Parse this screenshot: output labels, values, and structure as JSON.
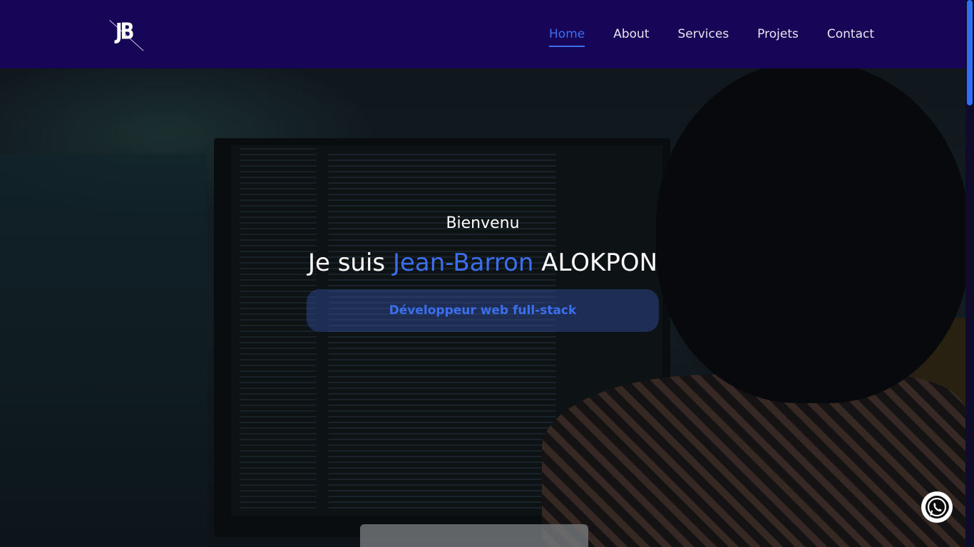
{
  "brand": {
    "logo_text": "JB"
  },
  "nav": {
    "items": [
      {
        "label": "Home",
        "active": true
      },
      {
        "label": "About"
      },
      {
        "label": "Services"
      },
      {
        "label": "Projets"
      },
      {
        "label": "Contact"
      }
    ]
  },
  "hero": {
    "greeting": "Bienvenu",
    "headline_prefix": "Je suis",
    "headline_name_accent": "Jean-Barron",
    "headline_name_rest": "ALOKPON",
    "role": "Développeur web full-stack"
  },
  "colors": {
    "navbar_bg": "#170657",
    "accent": "#3b6ff0"
  },
  "floating": {
    "icon": "whatsapp-icon"
  }
}
